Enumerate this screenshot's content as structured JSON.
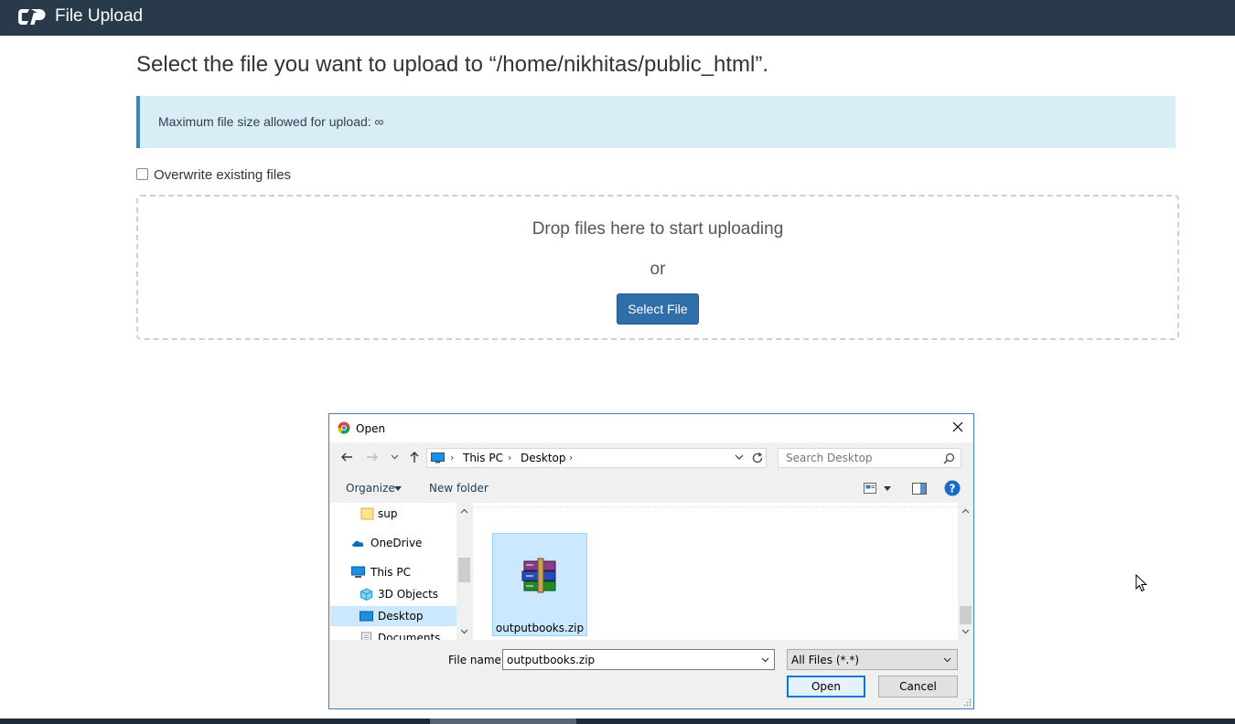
{
  "topbar": {
    "title": "File Upload"
  },
  "heading": "Select the file you want to upload to “/home/nikhitas/public_html”.",
  "alert": {
    "text": "Maximum file size allowed for upload: ∞"
  },
  "overwrite": {
    "label": "Overwrite existing files",
    "checked": false
  },
  "dropzone": {
    "drop_text": "Drop files here to start uploading",
    "or_text": "or",
    "select_button": "Select File"
  },
  "dialog": {
    "title": "Open",
    "address": {
      "segments": [
        "This PC",
        "Desktop"
      ]
    },
    "search": {
      "placeholder": "Search Desktop"
    },
    "commands": {
      "organize": "Organize",
      "new_folder": "New folder"
    },
    "nav_items": [
      {
        "label": "sup",
        "icon": "folder-icon",
        "selected": false
      },
      {
        "label": "OneDrive",
        "icon": "onedrive-icon",
        "selected": false
      },
      {
        "label": "This PC",
        "icon": "computer-icon",
        "selected": false
      },
      {
        "label": "3D Objects",
        "icon": "3d-objects-icon",
        "selected": false
      },
      {
        "label": "Desktop",
        "icon": "desktop-icon",
        "selected": true
      },
      {
        "label": "Documents",
        "icon": "documents-icon",
        "selected": false
      }
    ],
    "files": [
      {
        "name": "outputbooks.zip",
        "icon": "winrar-archive-icon",
        "selected": true
      }
    ],
    "file_name_label": "File name:",
    "file_name_value": "outputbooks.zip",
    "file_type": "All Files (*.*)",
    "open_button": "Open",
    "cancel_button": "Cancel"
  },
  "colors": {
    "topbar": "#293a4a",
    "alert_bg": "#d9edf7",
    "alert_border": "#3b86b9",
    "primary_button": "#2f6ea8",
    "selection": "#cce8ff",
    "dialog_border": "#3f7fc0"
  }
}
